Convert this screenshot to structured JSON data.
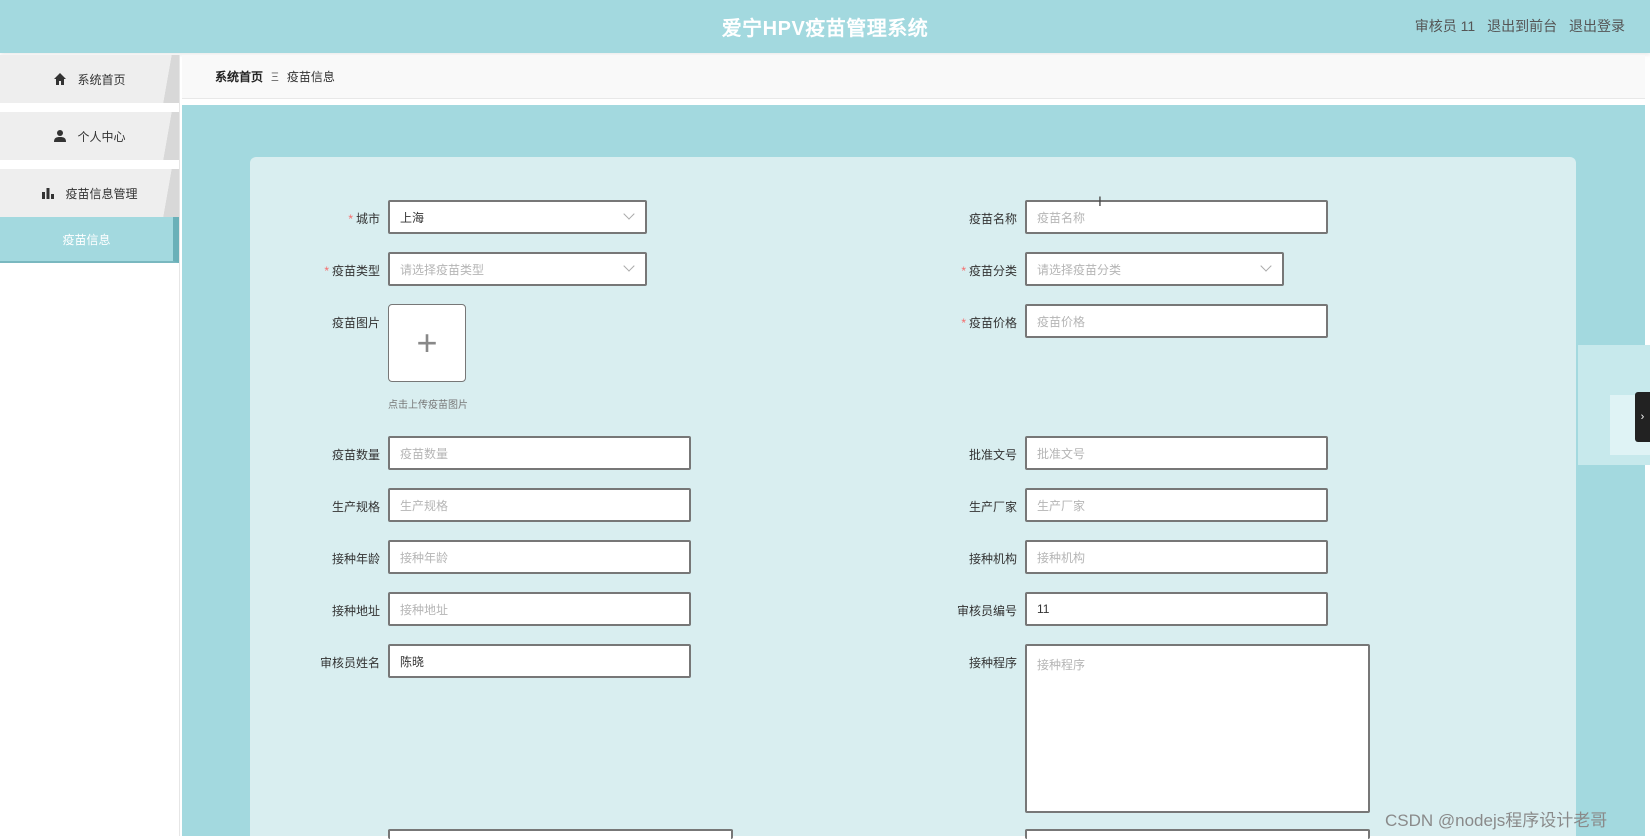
{
  "header": {
    "title": "爱宁HPV疫苗管理系统",
    "user_label": "审核员 11",
    "to_front": "退出到前台",
    "logout": "退出登录"
  },
  "sidebar": {
    "items": [
      {
        "label": "系统首页",
        "icon": "home-icon"
      },
      {
        "label": "个人中心",
        "icon": "user-icon"
      },
      {
        "label": "疫苗信息管理",
        "icon": "bar-chart-icon"
      }
    ],
    "active_sub": "疫苗信息"
  },
  "breadcrumb": {
    "home": "系统首页",
    "separator": "Ξ",
    "current": "疫苗信息"
  },
  "form": {
    "city": {
      "label": "城市",
      "value": "上海",
      "required": true
    },
    "vaccine_name": {
      "label": "疫苗名称",
      "placeholder": "疫苗名称"
    },
    "vaccine_type": {
      "label": "疫苗类型",
      "placeholder": "请选择疫苗类型",
      "required": true
    },
    "vaccine_category": {
      "label": "疫苗分类",
      "placeholder": "请选择疫苗分类",
      "required": true
    },
    "vaccine_image": {
      "label": "疫苗图片",
      "hint": "点击上传疫苗图片",
      "plus": "+"
    },
    "vaccine_price": {
      "label": "疫苗价格",
      "placeholder": "疫苗价格",
      "required": true
    },
    "vaccine_qty": {
      "label": "疫苗数量",
      "placeholder": "疫苗数量"
    },
    "approval_no": {
      "label": "批准文号",
      "placeholder": "批准文号"
    },
    "spec": {
      "label": "生产规格",
      "placeholder": "生产规格"
    },
    "manufacturer": {
      "label": "生产厂家",
      "placeholder": "生产厂家"
    },
    "age": {
      "label": "接种年龄",
      "placeholder": "接种年龄"
    },
    "institution": {
      "label": "接种机构",
      "placeholder": "接种机构"
    },
    "address": {
      "label": "接种地址",
      "placeholder": "接种地址"
    },
    "reviewer_no": {
      "label": "审核员编号",
      "value": "11"
    },
    "reviewer_name": {
      "label": "审核员姓名",
      "value": "陈晓"
    },
    "procedure": {
      "label": "接种程序",
      "placeholder": "接种程序"
    }
  },
  "watermark": "CSDN @nodejs程序设计老哥",
  "right_tab_glyph": "›",
  "colors": {
    "header_bg": "#a3d9df",
    "content_bg": "#a3d9df",
    "card_bg": "#d9eef0",
    "required": "#f56c6c"
  }
}
